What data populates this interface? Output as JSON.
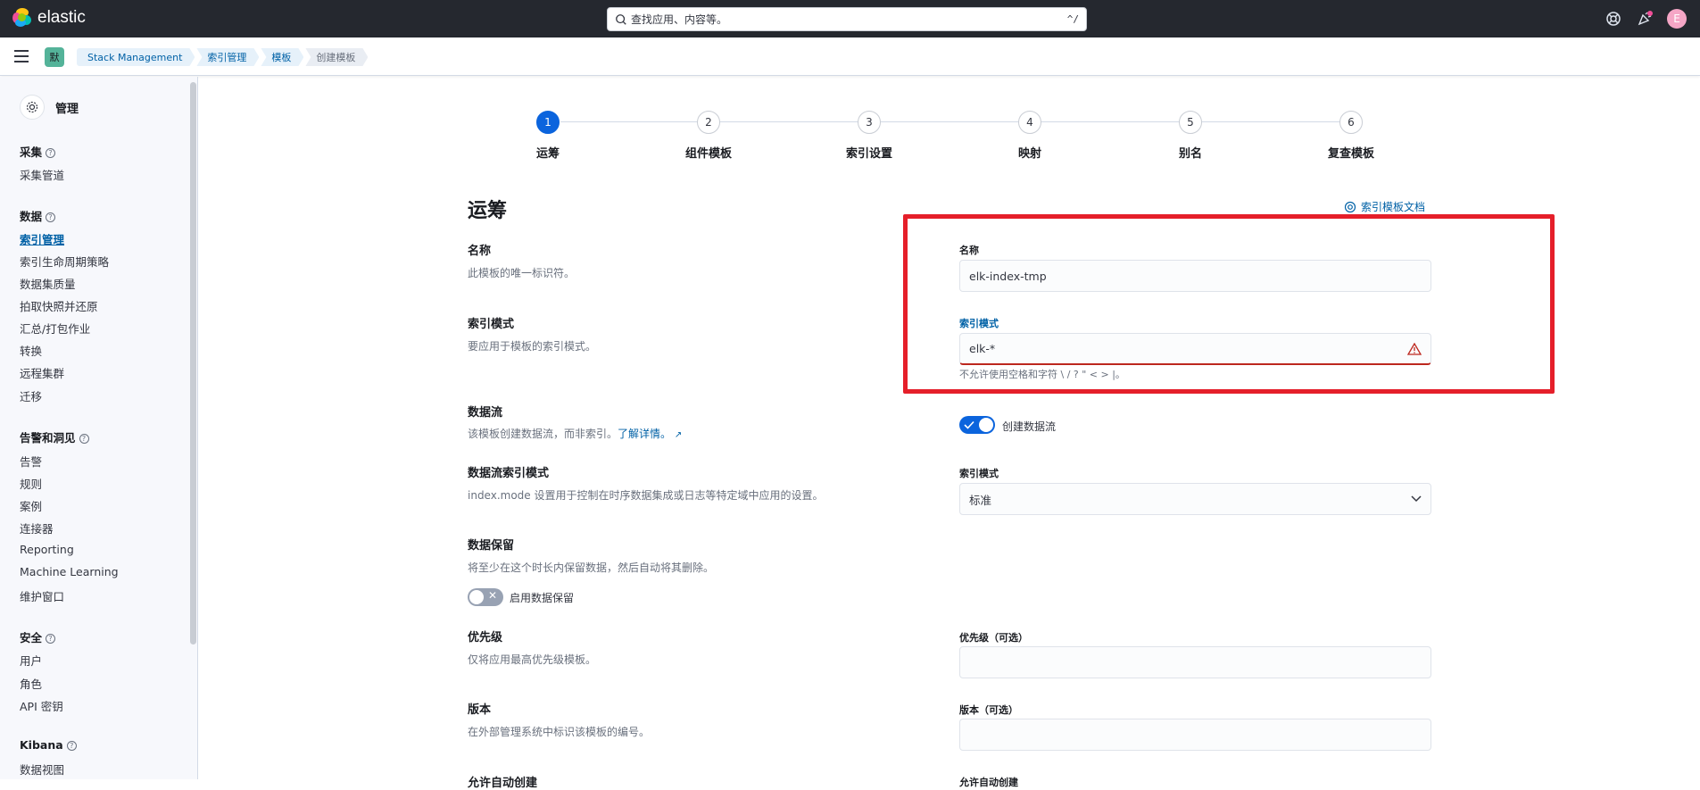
{
  "topbar": {
    "brand": "elastic",
    "search_placeholder": "查找应用、内容等。",
    "search_shortcut": "^/",
    "avatar_initial": "E",
    "icons": [
      "help-icon",
      "news-icon"
    ]
  },
  "breadcrumb": {
    "space_badge": "默",
    "items": [
      "Stack Management",
      "索引管理",
      "模板",
      "创建模板"
    ]
  },
  "sidebar": {
    "title": "管理",
    "groups": [
      {
        "label": "采集",
        "items": [
          "采集管道"
        ]
      },
      {
        "label": "数据",
        "items": [
          "索引管理",
          "索引生命周期策略",
          "数据集质量",
          "拍取快照并还原",
          "汇总/打包作业",
          "转换",
          "远程集群",
          "迁移"
        ]
      },
      {
        "label": "告警和洞见",
        "items": [
          "告警",
          "规则",
          "案例",
          "连接器",
          "Reporting",
          "Machine Learning",
          "维护窗口"
        ]
      },
      {
        "label": "安全",
        "items": [
          "用户",
          "角色",
          "API 密钥"
        ]
      },
      {
        "label": "Kibana",
        "items": [
          "数据视图"
        ]
      }
    ],
    "active_item": "索引管理"
  },
  "steps": [
    {
      "num": "1",
      "label": "运筹",
      "active": true
    },
    {
      "num": "2",
      "label": "组件模板",
      "active": false
    },
    {
      "num": "3",
      "label": "索引设置",
      "active": false
    },
    {
      "num": "4",
      "label": "映射",
      "active": false
    },
    {
      "num": "5",
      "label": "别名",
      "active": false
    },
    {
      "num": "6",
      "label": "复查模板",
      "active": false
    }
  ],
  "main": {
    "title": "运筹",
    "doc_link": "索引模板文档",
    "sections": {
      "name": {
        "title": "名称",
        "desc": "此模板的唯一标识符。",
        "field_label": "名称",
        "value": "elk-index-tmp"
      },
      "pattern": {
        "title": "索引模式",
        "desc": "要应用于模板的索引模式。",
        "field_label": "索引模式",
        "value": "elk-*",
        "help": "不允许使用空格和字符 \\ / ? \" < > |。"
      },
      "datastream": {
        "title": "数据流",
        "desc": "该模板创建数据流，而非索引。",
        "link": "了解详情。",
        "toggle_label": "创建数据流",
        "toggle_on": true
      },
      "index_mode": {
        "title": "数据流索引模式",
        "desc": "index.mode 设置用于控制在时序数据集成或日志等特定域中应用的设置。",
        "field_label": "索引模式",
        "value": "标准"
      },
      "retention": {
        "title": "数据保留",
        "desc": "将至少在这个时长内保留数据，然后自动将其删除。",
        "toggle_label": "启用数据保留",
        "toggle_on": false
      },
      "priority": {
        "title": "优先级",
        "desc": "仅将应用最高优先级模板。",
        "field_label": "优先级（可选）",
        "value": ""
      },
      "version": {
        "title": "版本",
        "desc": "在外部管理系统中标识该模板的编号。",
        "field_label": "版本（可选）",
        "value": ""
      },
      "auto_create": {
        "title": "允许自动创建",
        "field_label": "允许自动创建"
      }
    }
  },
  "colors": {
    "accent": "#0b64dd",
    "highlight": "#e51f2a",
    "error": "#bd271e"
  }
}
